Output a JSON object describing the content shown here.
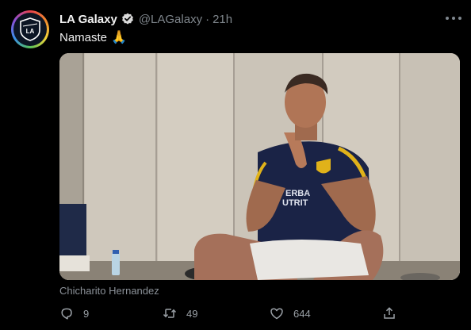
{
  "tweet": {
    "display_name": "LA Galaxy",
    "handle": "@LAGalaxy",
    "separator": "·",
    "time": "21h",
    "text": "Namaste",
    "emoji": "🙏",
    "media_caption": "Chicharito Hernandez",
    "verified": true
  },
  "avatar": {
    "logo_text": "LA",
    "colors": [
      "#e8414c",
      "#f08a2e",
      "#f2d43a",
      "#59c35a",
      "#3a8ee8",
      "#8a4fd6"
    ]
  },
  "actions": {
    "reply_count": "9",
    "retweet_count": "49",
    "like_count": "644"
  },
  "icons": [
    "verified-badge-icon",
    "more-options-icon",
    "reply-icon",
    "retweet-icon",
    "like-icon",
    "share-icon"
  ],
  "colors": {
    "background": "#000000",
    "text_primary": "#efefef",
    "text_secondary": "#7f868c",
    "verified_badge": "#d9d9d9"
  }
}
